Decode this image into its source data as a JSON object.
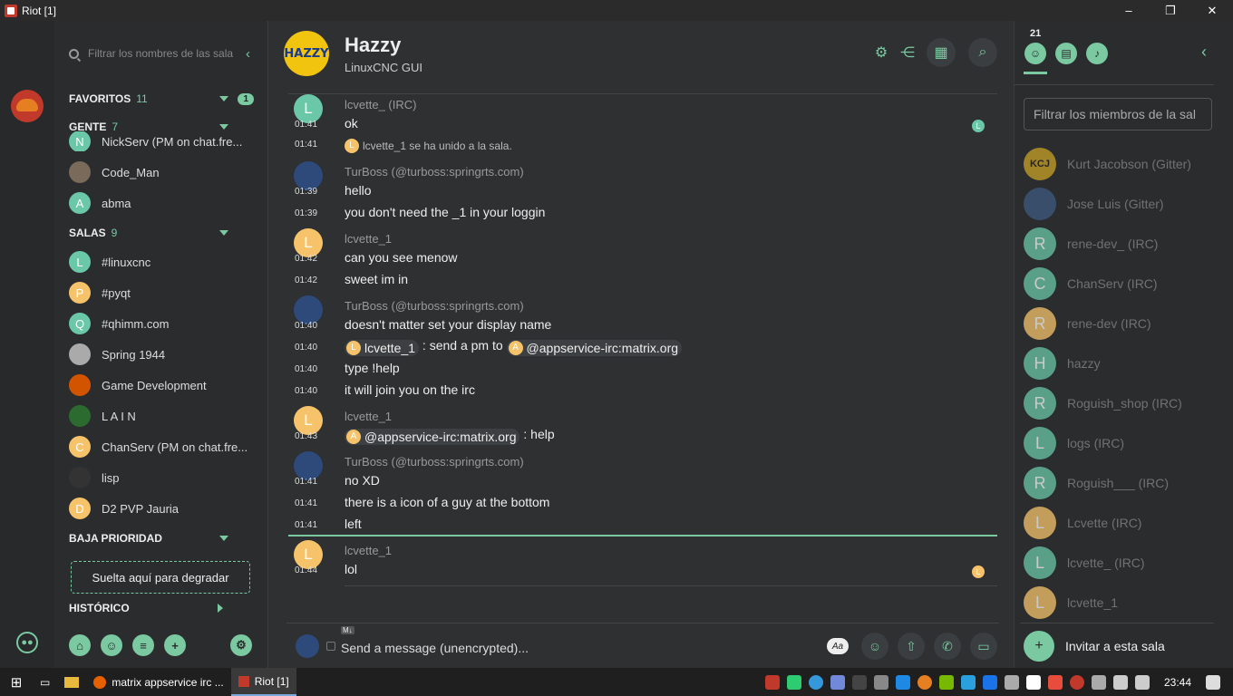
{
  "window": {
    "title": "Riot [1]",
    "min": "–",
    "max": "❐",
    "close": "✕"
  },
  "roomlist": {
    "filter_placeholder": "Filtrar los nombres de las sala",
    "sections": {
      "favoritos": {
        "label": "FAVORITOS",
        "count": "11",
        "badge": "1"
      },
      "gente": {
        "label": "GENTE",
        "count": "7"
      },
      "salas": {
        "label": "SALAS",
        "count": "9"
      },
      "baja": {
        "label": "BAJA PRIORIDAD"
      },
      "historico": {
        "label": "HISTÓRICO"
      }
    },
    "people": [
      {
        "name": "NickServ (PM on chat.fre...",
        "letter": "N",
        "color": "#6ac7a8"
      },
      {
        "name": "Code_Man",
        "letter": "",
        "color": "#7a6a5a"
      },
      {
        "name": "abma",
        "letter": "A",
        "color": "#6ac7a8"
      }
    ],
    "rooms": [
      {
        "name": "#linuxcnc",
        "letter": "L",
        "color": "#6ac7a8"
      },
      {
        "name": "#pyqt",
        "letter": "P",
        "color": "#f6c36a"
      },
      {
        "name": "#qhimm.com",
        "letter": "Q",
        "color": "#6ac7a8"
      },
      {
        "name": "Spring 1944",
        "letter": "",
        "color": "#aaaaaa"
      },
      {
        "name": "Game Development",
        "letter": "",
        "color": "#d35400"
      },
      {
        "name": "L A I N",
        "letter": "",
        "color": "#2c6b2f"
      },
      {
        "name": "ChanServ (PM on chat.fre...",
        "letter": "C",
        "color": "#f6c36a"
      },
      {
        "name": "lisp",
        "letter": "",
        "color": "#333333"
      },
      {
        "name": "D2 PVP Jauria",
        "letter": "D",
        "color": "#f6c36a"
      }
    ],
    "dropzone": "Suelta aquí para degradar"
  },
  "room": {
    "name": "Hazzy",
    "topic": "LinuxCNC GUI",
    "avatar_text": "HAZZY"
  },
  "messages": [
    {
      "sender": "lcvette_ (IRC)",
      "time": "01:41",
      "body": "ok",
      "avatar": "L",
      "color": "#6ac7a8"
    },
    {
      "time": "01:41",
      "body": "lcvette_1 se ha unido a la sala."
    },
    {
      "sender": "TurBoss (@turboss:springrts.com)",
      "time": "01:39",
      "body": "hello"
    },
    {
      "time": "01:39",
      "body": "you don't need the _1 in your loggin"
    },
    {
      "sender": "lcvette_1",
      "time": "01:42",
      "body": "can you see menow",
      "avatar": "L"
    },
    {
      "time": "01:42",
      "body": "sweet im in"
    },
    {
      "sender": "TurBoss (@turboss:springrts.com)",
      "time": "01:40",
      "body": "doesn't matter set your display name"
    },
    {
      "time": "01:40",
      "pill1": "lcvette_1",
      "mid": " : send a pm to ",
      "pill2": "@appservice-irc:matrix.org"
    },
    {
      "time": "01:40",
      "body": "type !help"
    },
    {
      "time": "01:40",
      "body": "it will join you on the irc"
    },
    {
      "sender": "lcvette_1",
      "time": "01:43",
      "pill": "@appservice-irc:matrix.org",
      "after": " : help",
      "avatar": "L"
    },
    {
      "sender": "TurBoss (@turboss:springrts.com)",
      "time": "01:41",
      "body": "no XD"
    },
    {
      "time": "01:41",
      "body": "there is a icon of a guy at the bottom"
    },
    {
      "time": "01:41",
      "body": "left"
    },
    {
      "sender": "lcvette_1",
      "time": "01:44",
      "body": "lol",
      "avatar": "L"
    }
  ],
  "composer": {
    "placeholder": "Send a message (unencrypted)...",
    "md": "M↓",
    "aa": "Aa"
  },
  "members": {
    "count": "21",
    "filter_placeholder": "Filtrar los miembros de la sal",
    "list": [
      {
        "name": "Kurt Jacobson (Gitter)",
        "letter": "KCJ",
        "color": "#c9a227"
      },
      {
        "name": "Jose Luis (Gitter)",
        "letter": "",
        "color": "#3d5a80"
      },
      {
        "name": "rene-dev_ (IRC)",
        "letter": "R",
        "color": "#6ac7a8"
      },
      {
        "name": "ChanServ (IRC)",
        "letter": "C",
        "color": "#6ac7a8"
      },
      {
        "name": "rene-dev (IRC)",
        "letter": "R",
        "color": "#f6c36a"
      },
      {
        "name": "hazzy",
        "letter": "H",
        "color": "#6ac7a8"
      },
      {
        "name": "Roguish_shop (IRC)",
        "letter": "R",
        "color": "#6ac7a8"
      },
      {
        "name": "logs (IRC)",
        "letter": "L",
        "color": "#6ac7a8"
      },
      {
        "name": "Roguish___ (IRC)",
        "letter": "R",
        "color": "#6ac7a8"
      },
      {
        "name": "Lcvette (IRC)",
        "letter": "L",
        "color": "#f6c36a"
      },
      {
        "name": "lcvette_ (IRC)",
        "letter": "L",
        "color": "#6ac7a8"
      },
      {
        "name": "lcvette_1",
        "letter": "L",
        "color": "#f6c36a"
      }
    ],
    "invite": "Invitar a esta sala"
  },
  "taskbar": {
    "firefox": "matrix appservice irc ...",
    "riot": "Riot [1]",
    "clock": "23:44"
  },
  "colors": {
    "accent": "#7ac9a1",
    "bg": "#2e3032"
  }
}
